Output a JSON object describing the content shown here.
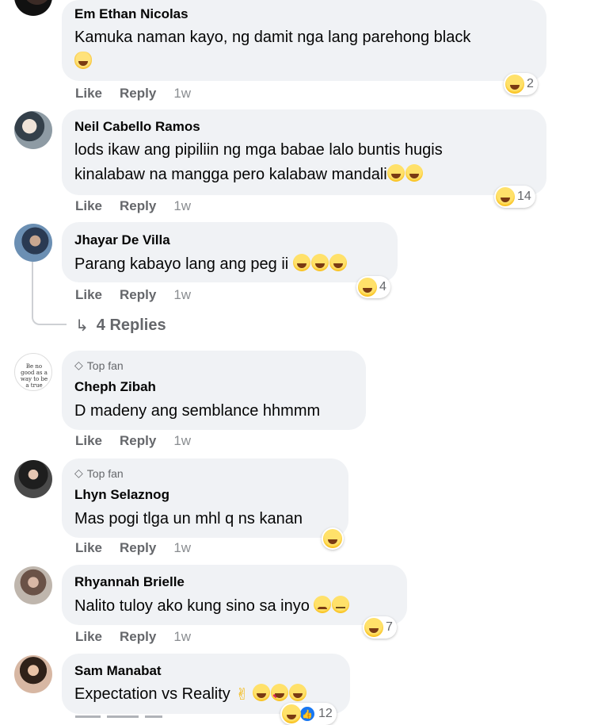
{
  "comments": [
    {
      "name": "Em Ethan Nicolas",
      "text1": "Kamuka naman kayo, ng damit nga lang parehong black",
      "reaction_count": "2",
      "like": "Like",
      "reply": "Reply",
      "time": "1w"
    },
    {
      "name": "Neil Cabello Ramos",
      "text1": "lods ikaw ang pipiliin ng mga babae lalo buntis hugis",
      "text2": "kinalabaw na mangga pero kalabaw mandali",
      "reaction_count": "14",
      "like": "Like",
      "reply": "Reply",
      "time": "1w"
    },
    {
      "name": "Jhayar De Villa",
      "text1": "Parang kabayo lang ang peg ii",
      "reaction_count": "4",
      "like": "Like",
      "reply": "Reply",
      "time": "1w",
      "replies_label": "4 Replies"
    },
    {
      "badge": "Top fan",
      "name": "Cheph Zibah",
      "text1": "D madeny ang semblance hhmmm",
      "like": "Like",
      "reply": "Reply",
      "time": "1w",
      "avatar_text": "Be no good as a way to be a true"
    },
    {
      "badge": "Top fan",
      "name": "Lhyn Selaznog",
      "text1": "Mas pogi tlga un mhl q ns kanan",
      "like": "Like",
      "reply": "Reply",
      "time": "1w"
    },
    {
      "name": "Rhyannah Brielle",
      "text1": "Nalito tuloy ako kung sino sa inyo",
      "reaction_count": "7",
      "like": "Like",
      "reply": "Reply",
      "time": "1w"
    },
    {
      "name": "Sam Manabat",
      "text1": "Expectation vs Reality",
      "reaction_count": "12"
    }
  ],
  "icons": {
    "reaction": "haha-reaction-icon",
    "like_reaction": "like-reaction-icon",
    "badge": "diamond-icon",
    "replies": "reply-arrow-icon"
  }
}
